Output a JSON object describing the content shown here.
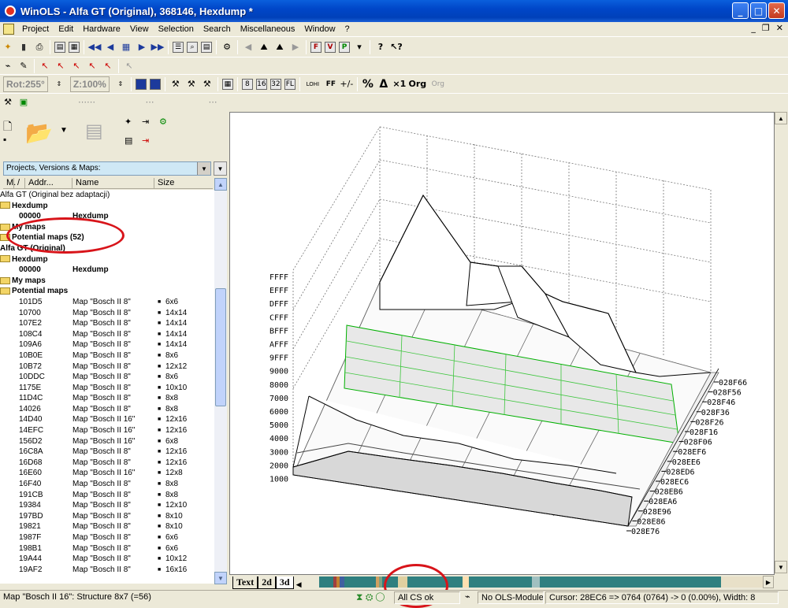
{
  "window": {
    "title": "WinOLS - Alfa GT (Original), 368146, Hexdump *",
    "minimize_glyph": "_",
    "maximize_glyph": "□",
    "close_glyph": "✕"
  },
  "menubar": {
    "items": [
      "Project",
      "Edit",
      "Hardware",
      "View",
      "Selection",
      "Search",
      "Miscellaneous",
      "Window",
      "?"
    ],
    "mdi_min": "_",
    "mdi_restore": "❐",
    "mdi_close": "✕"
  },
  "toolbar3": {
    "rotation_label": "Rot:255°",
    "zoom_label": "Z:100%",
    "hex_labels": [
      "8",
      "16",
      "32",
      "FL"
    ],
    "lohi_label": "LOHI",
    "ff_label": "FF",
    "percent_label": "%",
    "delta_label": "Δ",
    "x1_label": "×1",
    "org_label": "Org",
    "org2_label": "Org"
  },
  "left_panel": {
    "combo_value": "Projects, Versions & Maps:",
    "columns": [
      "M.",
      "/",
      "Addr...",
      "Name",
      "Size"
    ],
    "tree": [
      {
        "text": "Alfa GT (Original bez adaptacji)",
        "indent": 0,
        "bold": false,
        "folder": false
      },
      {
        "text": "Hexdump",
        "indent": 0,
        "bold": true,
        "folder": true
      },
      {
        "addr": "00000",
        "name": "Hexdump",
        "indent": 1,
        "bold": true
      },
      {
        "text": "My maps",
        "indent": 0,
        "bold": true,
        "folder": true
      },
      {
        "text": "Potential maps (52)",
        "indent": 0,
        "bold": true,
        "folder": true
      },
      {
        "text": "Alfa GT (Original)",
        "indent": 0,
        "bold": true,
        "folder": false
      },
      {
        "text": "Hexdump",
        "indent": 0,
        "bold": true,
        "folder": true
      },
      {
        "addr": "00000",
        "name": "Hexdump",
        "indent": 1,
        "bold": true
      },
      {
        "text": "My maps",
        "indent": 0,
        "bold": true,
        "folder": true
      },
      {
        "text": "Potential maps",
        "indent": 0,
        "bold": true,
        "folder": true
      }
    ],
    "maps": [
      {
        "addr": "101D5",
        "name": "Map \"Bosch II 8\"",
        "size": "6x6"
      },
      {
        "addr": "10700",
        "name": "Map \"Bosch II 8\"",
        "size": "14x14"
      },
      {
        "addr": "107E2",
        "name": "Map \"Bosch II 8\"",
        "size": "14x14"
      },
      {
        "addr": "108C4",
        "name": "Map \"Bosch II 8\"",
        "size": "14x14"
      },
      {
        "addr": "109A6",
        "name": "Map \"Bosch II 8\"",
        "size": "14x14"
      },
      {
        "addr": "10B0E",
        "name": "Map \"Bosch II 8\"",
        "size": "8x6"
      },
      {
        "addr": "10B72",
        "name": "Map \"Bosch II 8\"",
        "size": "12x12"
      },
      {
        "addr": "10DDC",
        "name": "Map \"Bosch II 8\"",
        "size": "8x6"
      },
      {
        "addr": "1175E",
        "name": "Map \"Bosch II 8\"",
        "size": "10x10"
      },
      {
        "addr": "11D4C",
        "name": "Map \"Bosch II 8\"",
        "size": "8x8"
      },
      {
        "addr": "14026",
        "name": "Map \"Bosch II 8\"",
        "size": "8x8"
      },
      {
        "addr": "14D40",
        "name": "Map \"Bosch II 16\"",
        "size": "12x16"
      },
      {
        "addr": "14EFC",
        "name": "Map \"Bosch II 16\"",
        "size": "12x16"
      },
      {
        "addr": "156D2",
        "name": "Map \"Bosch II 16\"",
        "size": "6x8"
      },
      {
        "addr": "16C8A",
        "name": "Map \"Bosch II 8\"",
        "size": "12x16"
      },
      {
        "addr": "16D68",
        "name": "Map \"Bosch II 8\"",
        "size": "12x16"
      },
      {
        "addr": "16E60",
        "name": "Map \"Bosch II 16\"",
        "size": "12x8"
      },
      {
        "addr": "16F40",
        "name": "Map \"Bosch II 8\"",
        "size": "8x8"
      },
      {
        "addr": "191CB",
        "name": "Map \"Bosch II 8\"",
        "size": "8x8"
      },
      {
        "addr": "19384",
        "name": "Map \"Bosch II 8\"",
        "size": "12x10"
      },
      {
        "addr": "197BD",
        "name": "Map \"Bosch II 8\"",
        "size": "8x10"
      },
      {
        "addr": "19821",
        "name": "Map \"Bosch II 8\"",
        "size": "8x10"
      },
      {
        "addr": "1987F",
        "name": "Map \"Bosch II 8\"",
        "size": "6x6"
      },
      {
        "addr": "198B1",
        "name": "Map \"Bosch II 8\"",
        "size": "6x6"
      },
      {
        "addr": "19A44",
        "name": "Map \"Bosch II 8\"",
        "size": "10x12"
      },
      {
        "addr": "19AF2",
        "name": "Map \"Bosch II 8\"",
        "size": "16x16"
      }
    ]
  },
  "graph": {
    "y_labels": [
      "FFFF",
      "EFFF",
      "DFFF",
      "CFFF",
      "BFFF",
      "AFFF",
      "9FFF",
      "9000",
      "8000",
      "7000",
      "6000",
      "5000",
      "4000",
      "3000",
      "2000",
      "1000"
    ],
    "right_labels": [
      "028F66",
      "028F56",
      "028F46",
      "028F36",
      "028F26",
      "028F16",
      "028F06",
      "028EF6",
      "028EE6",
      "028ED6",
      "028EC6",
      "028EB6",
      "028EA6",
      "028E96",
      "028E86",
      "028E76"
    ]
  },
  "tabs": [
    "Text",
    "2d",
    "3d"
  ],
  "statusbar": {
    "left": "Map \"Bosch II 16\": Structure 8x7 (=56)",
    "cs": "All CS ok",
    "module": "No OLS-Module",
    "cursor": "Cursor: 28EC6 => 0764 (0764) -> 0 (0.00%), Width: 8"
  }
}
